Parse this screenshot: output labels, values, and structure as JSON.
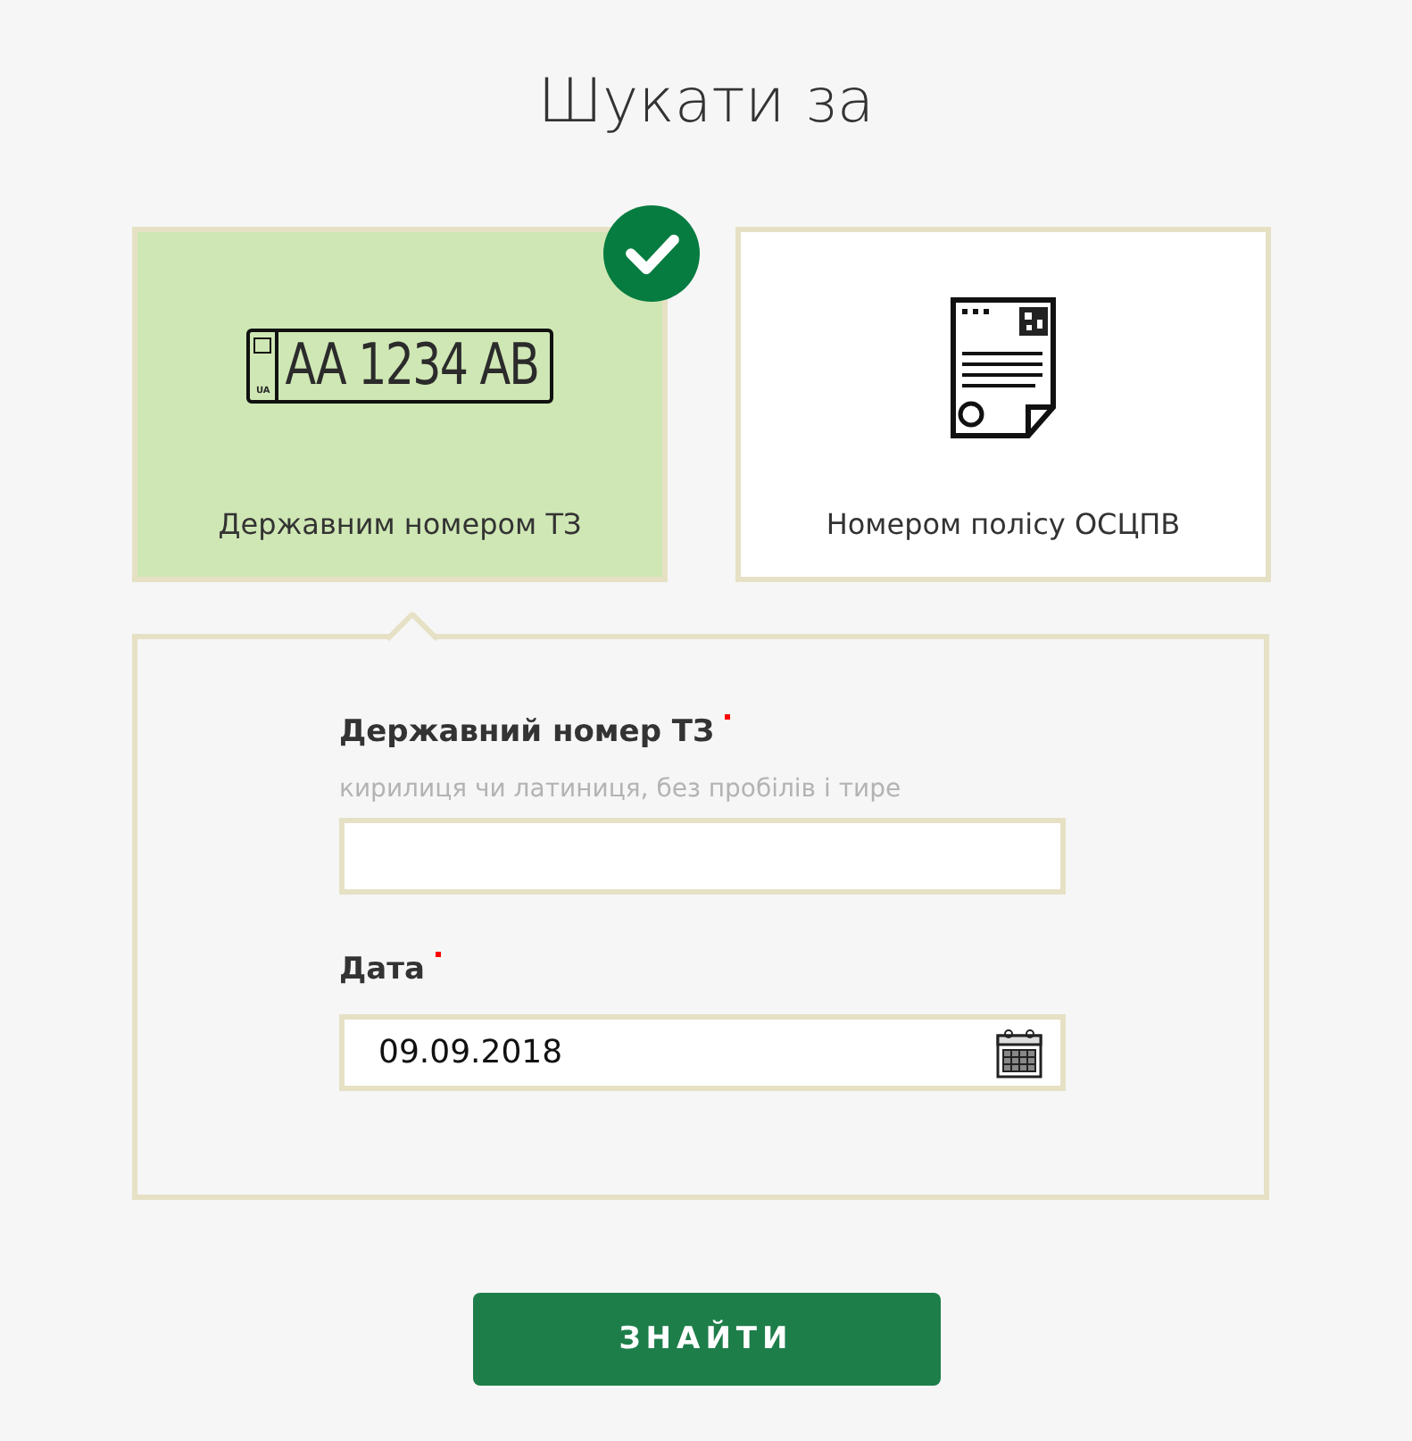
{
  "title": "Шукати за",
  "options": [
    {
      "kind": "plate",
      "label": "Державним номером ТЗ",
      "plate_text": "AA 1234 AB",
      "plate_country": "UA",
      "selected": true
    },
    {
      "kind": "document",
      "label": "Номером полісу ОСЦПВ",
      "selected": false
    }
  ],
  "form": {
    "fields": [
      {
        "kind": "text",
        "label": "Державний номер ТЗ",
        "required": true,
        "hint": "кирилиця чи латиниця, без пробілів і тире"
      },
      {
        "kind": "date",
        "label": "Дата",
        "required": true,
        "value": "09.09.2018"
      }
    ]
  },
  "submit": "ЗНАЙТИ"
}
